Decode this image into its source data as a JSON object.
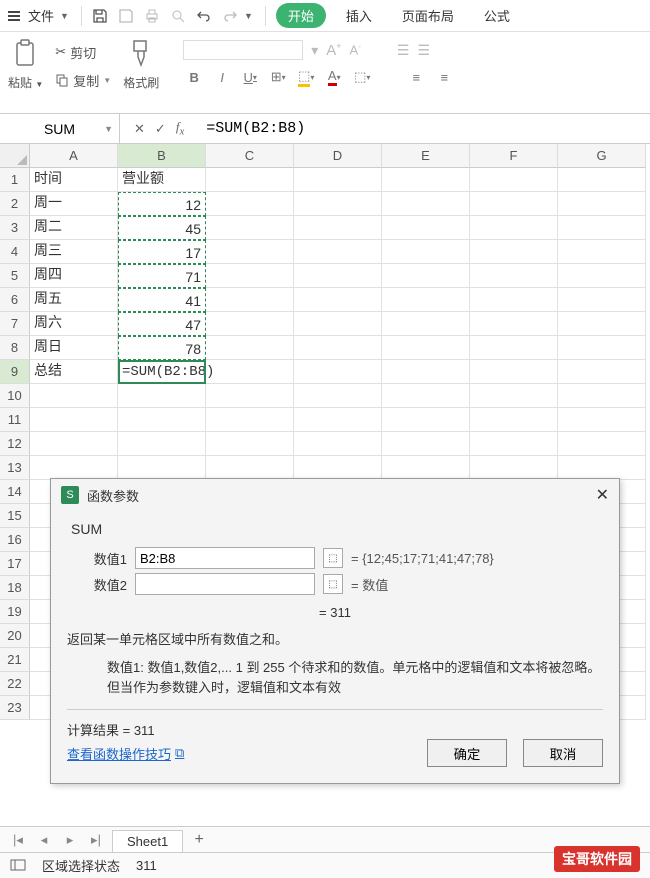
{
  "menu": {
    "file": "文件",
    "tabs": {
      "start": "开始",
      "insert": "插入",
      "layout": "页面布局",
      "formula": "公式"
    }
  },
  "ribbon": {
    "paste": "粘贴",
    "cut": "剪切",
    "copy": "复制",
    "format_painter": "格式刷",
    "bold": "B",
    "italic": "I",
    "underline": "U"
  },
  "formula_bar": {
    "name_box": "SUM",
    "formula": "=SUM(B2:B8)"
  },
  "columns": [
    "A",
    "B",
    "C",
    "D",
    "E",
    "F",
    "G"
  ],
  "rows": [
    {
      "n": 1,
      "A": "时间",
      "B": "营业额"
    },
    {
      "n": 2,
      "A": "周一",
      "B": "12"
    },
    {
      "n": 3,
      "A": "周二",
      "B": "45"
    },
    {
      "n": 4,
      "A": "周三",
      "B": "17"
    },
    {
      "n": 5,
      "A": "周四",
      "B": "71"
    },
    {
      "n": 6,
      "A": "周五",
      "B": "41"
    },
    {
      "n": 7,
      "A": "周六",
      "B": "47"
    },
    {
      "n": 8,
      "A": "周日",
      "B": "78"
    },
    {
      "n": 9,
      "A": "总结",
      "B": "=SUM(B2:B8)"
    }
  ],
  "dialog": {
    "title": "函数参数",
    "func": "SUM",
    "param1_label": "数值1",
    "param1_value": "B2:B8",
    "param1_result": "= {12;45;17;71;41;47;78}",
    "param2_label": "数值2",
    "param2_result": "= 数值",
    "eq_result": "= 311",
    "desc": "返回某一单元格区域中所有数值之和。",
    "param_desc_label": "数值1:",
    "param_desc_text": "数值1,数值2,... 1 到 255 个待求和的数值。单元格中的逻辑值和文本将被忽略。但当作为参数键入时，逻辑值和文本有效",
    "calc_result_label": "计算结果 = ",
    "calc_result_value": "311",
    "help_link": "查看函数操作技巧",
    "ok": "确定",
    "cancel": "取消"
  },
  "sheet": {
    "name": "Sheet1"
  },
  "status": {
    "mode": "区域选择状态",
    "value": "311"
  },
  "watermark": "宝哥软件园"
}
